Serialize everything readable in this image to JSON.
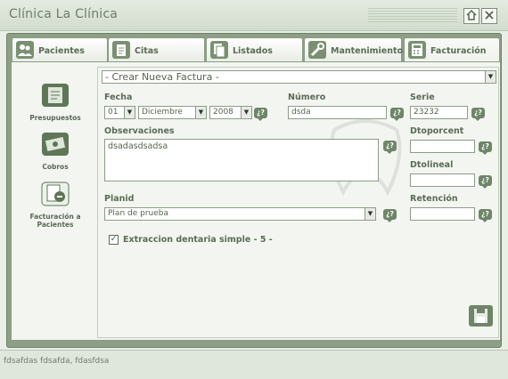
{
  "window": {
    "title": "Clínica La Clínica"
  },
  "tabs": [
    {
      "label": "Pacientes",
      "icon": "people-icon"
    },
    {
      "label": "Citas",
      "icon": "notepad-icon"
    },
    {
      "label": "Listados",
      "icon": "document-icon"
    },
    {
      "label": "Mantenimiento",
      "icon": "tools-icon"
    },
    {
      "label": "Facturación",
      "icon": "calculator-icon",
      "active": true
    }
  ],
  "sidebar": {
    "items": [
      {
        "label": "Presupuestos"
      },
      {
        "label": "Cobros"
      },
      {
        "label": "Facturación a Pacientes"
      }
    ]
  },
  "form": {
    "factura_select": "- Crear Nueva Factura -",
    "fecha_label": "Fecha",
    "fecha_day": "01",
    "fecha_month": "Diciembre",
    "fecha_year": "2008",
    "numero_label": "Número",
    "numero_value": "dsda",
    "serie_label": "Serie",
    "serie_value": "23232",
    "observaciones_label": "Observaciones",
    "observaciones_value": "dsadasdsadsa",
    "dtoporcent_label": "Dtoporcent",
    "dtoporcent_value": "",
    "dtolineal_label": "Dtolineal",
    "dtolineal_value": "",
    "planid_label": "Planid",
    "planid_value": "Plan de prueba",
    "retencion_label": "Retención",
    "retencion_value": "",
    "line_item": "Extraccion dentaria simple - 5 -",
    "help_symbol": "¿?"
  },
  "status": {
    "text": "fdsafdas fdsafda, fdasfdsa"
  },
  "colors": {
    "accent": "#6f8568",
    "background": "#f2f5f0",
    "frame": "#8da085"
  }
}
